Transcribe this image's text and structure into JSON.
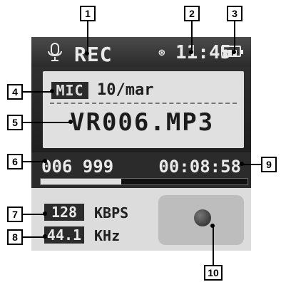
{
  "top_bar": {
    "mode_text": "REC",
    "time_text": "11:45"
  },
  "info": {
    "source_badge": "MIC",
    "date": "10/mar",
    "filename": "VR006.MP3"
  },
  "status": {
    "counter": "006 999",
    "elapsed_time": "00:08:58",
    "progress_fraction": 0.39
  },
  "audio": {
    "bitrate_value": "128",
    "bitrate_unit": "KBPS",
    "sample_rate_value": "44.1",
    "sample_rate_unit": "KHz"
  },
  "callouts": [
    "1",
    "2",
    "3",
    "4",
    "5",
    "6",
    "7",
    "8",
    "9",
    "10"
  ],
  "icons": {
    "mic": "mic-icon",
    "clock": "clock-icon",
    "battery": "battery-icon",
    "record": "record-icon"
  }
}
